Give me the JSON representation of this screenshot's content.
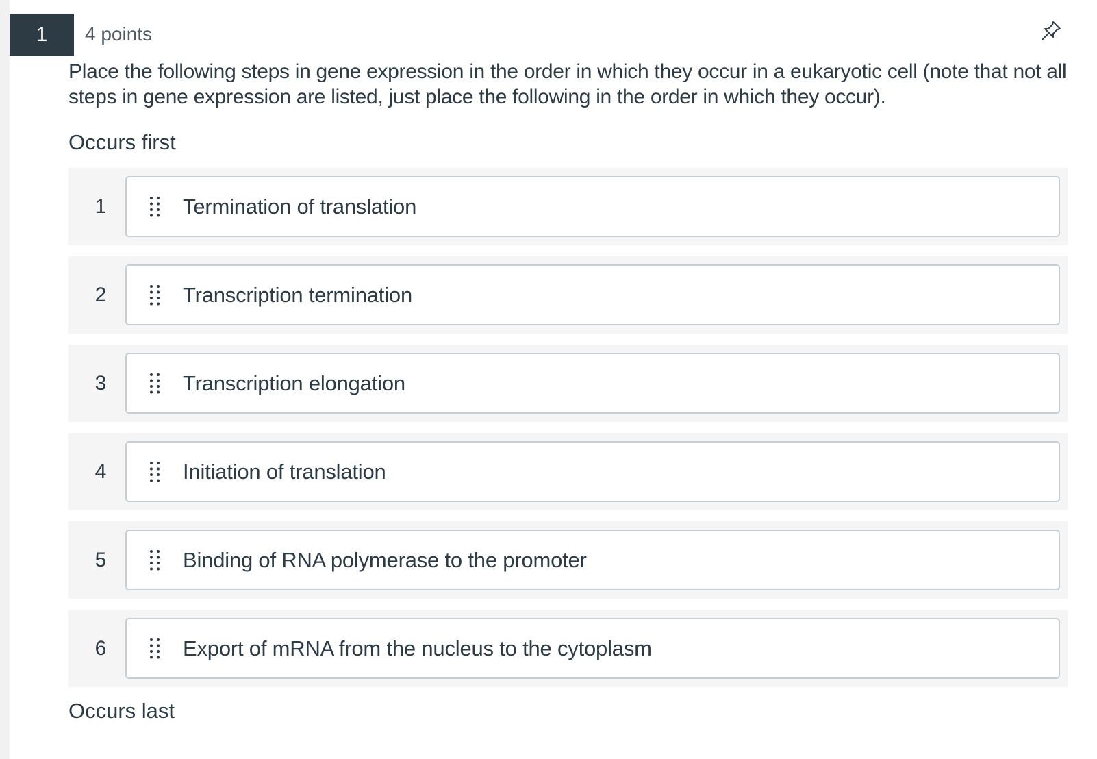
{
  "question": {
    "number": "1",
    "points": "4 points",
    "pin_icon": "pin-icon",
    "prompt": "Place the following steps in gene expression in the order in which they occur in a eukaryotic cell (note that not all steps in gene expression are listed, just place the following in the order in which they occur)."
  },
  "ordering": {
    "top_label": "Occurs first",
    "bottom_label": "Occurs last",
    "handle_icon": "drag-handle-icon",
    "items": [
      {
        "position": "1",
        "label": "Termination of translation"
      },
      {
        "position": "2",
        "label": "Transcription termination"
      },
      {
        "position": "3",
        "label": "Transcription elongation"
      },
      {
        "position": "4",
        "label": "Initiation of translation"
      },
      {
        "position": "5",
        "label": "Binding of RNA polymerase to the promoter"
      },
      {
        "position": "6",
        "label": "Export of mRNA from the nucleus to the cytoplasm"
      }
    ]
  },
  "colors": {
    "header_badge_bg": "#2d3b45",
    "text": "#2d3b45",
    "slot_bg": "#f5f5f5",
    "card_border": "#c7cdd1"
  }
}
